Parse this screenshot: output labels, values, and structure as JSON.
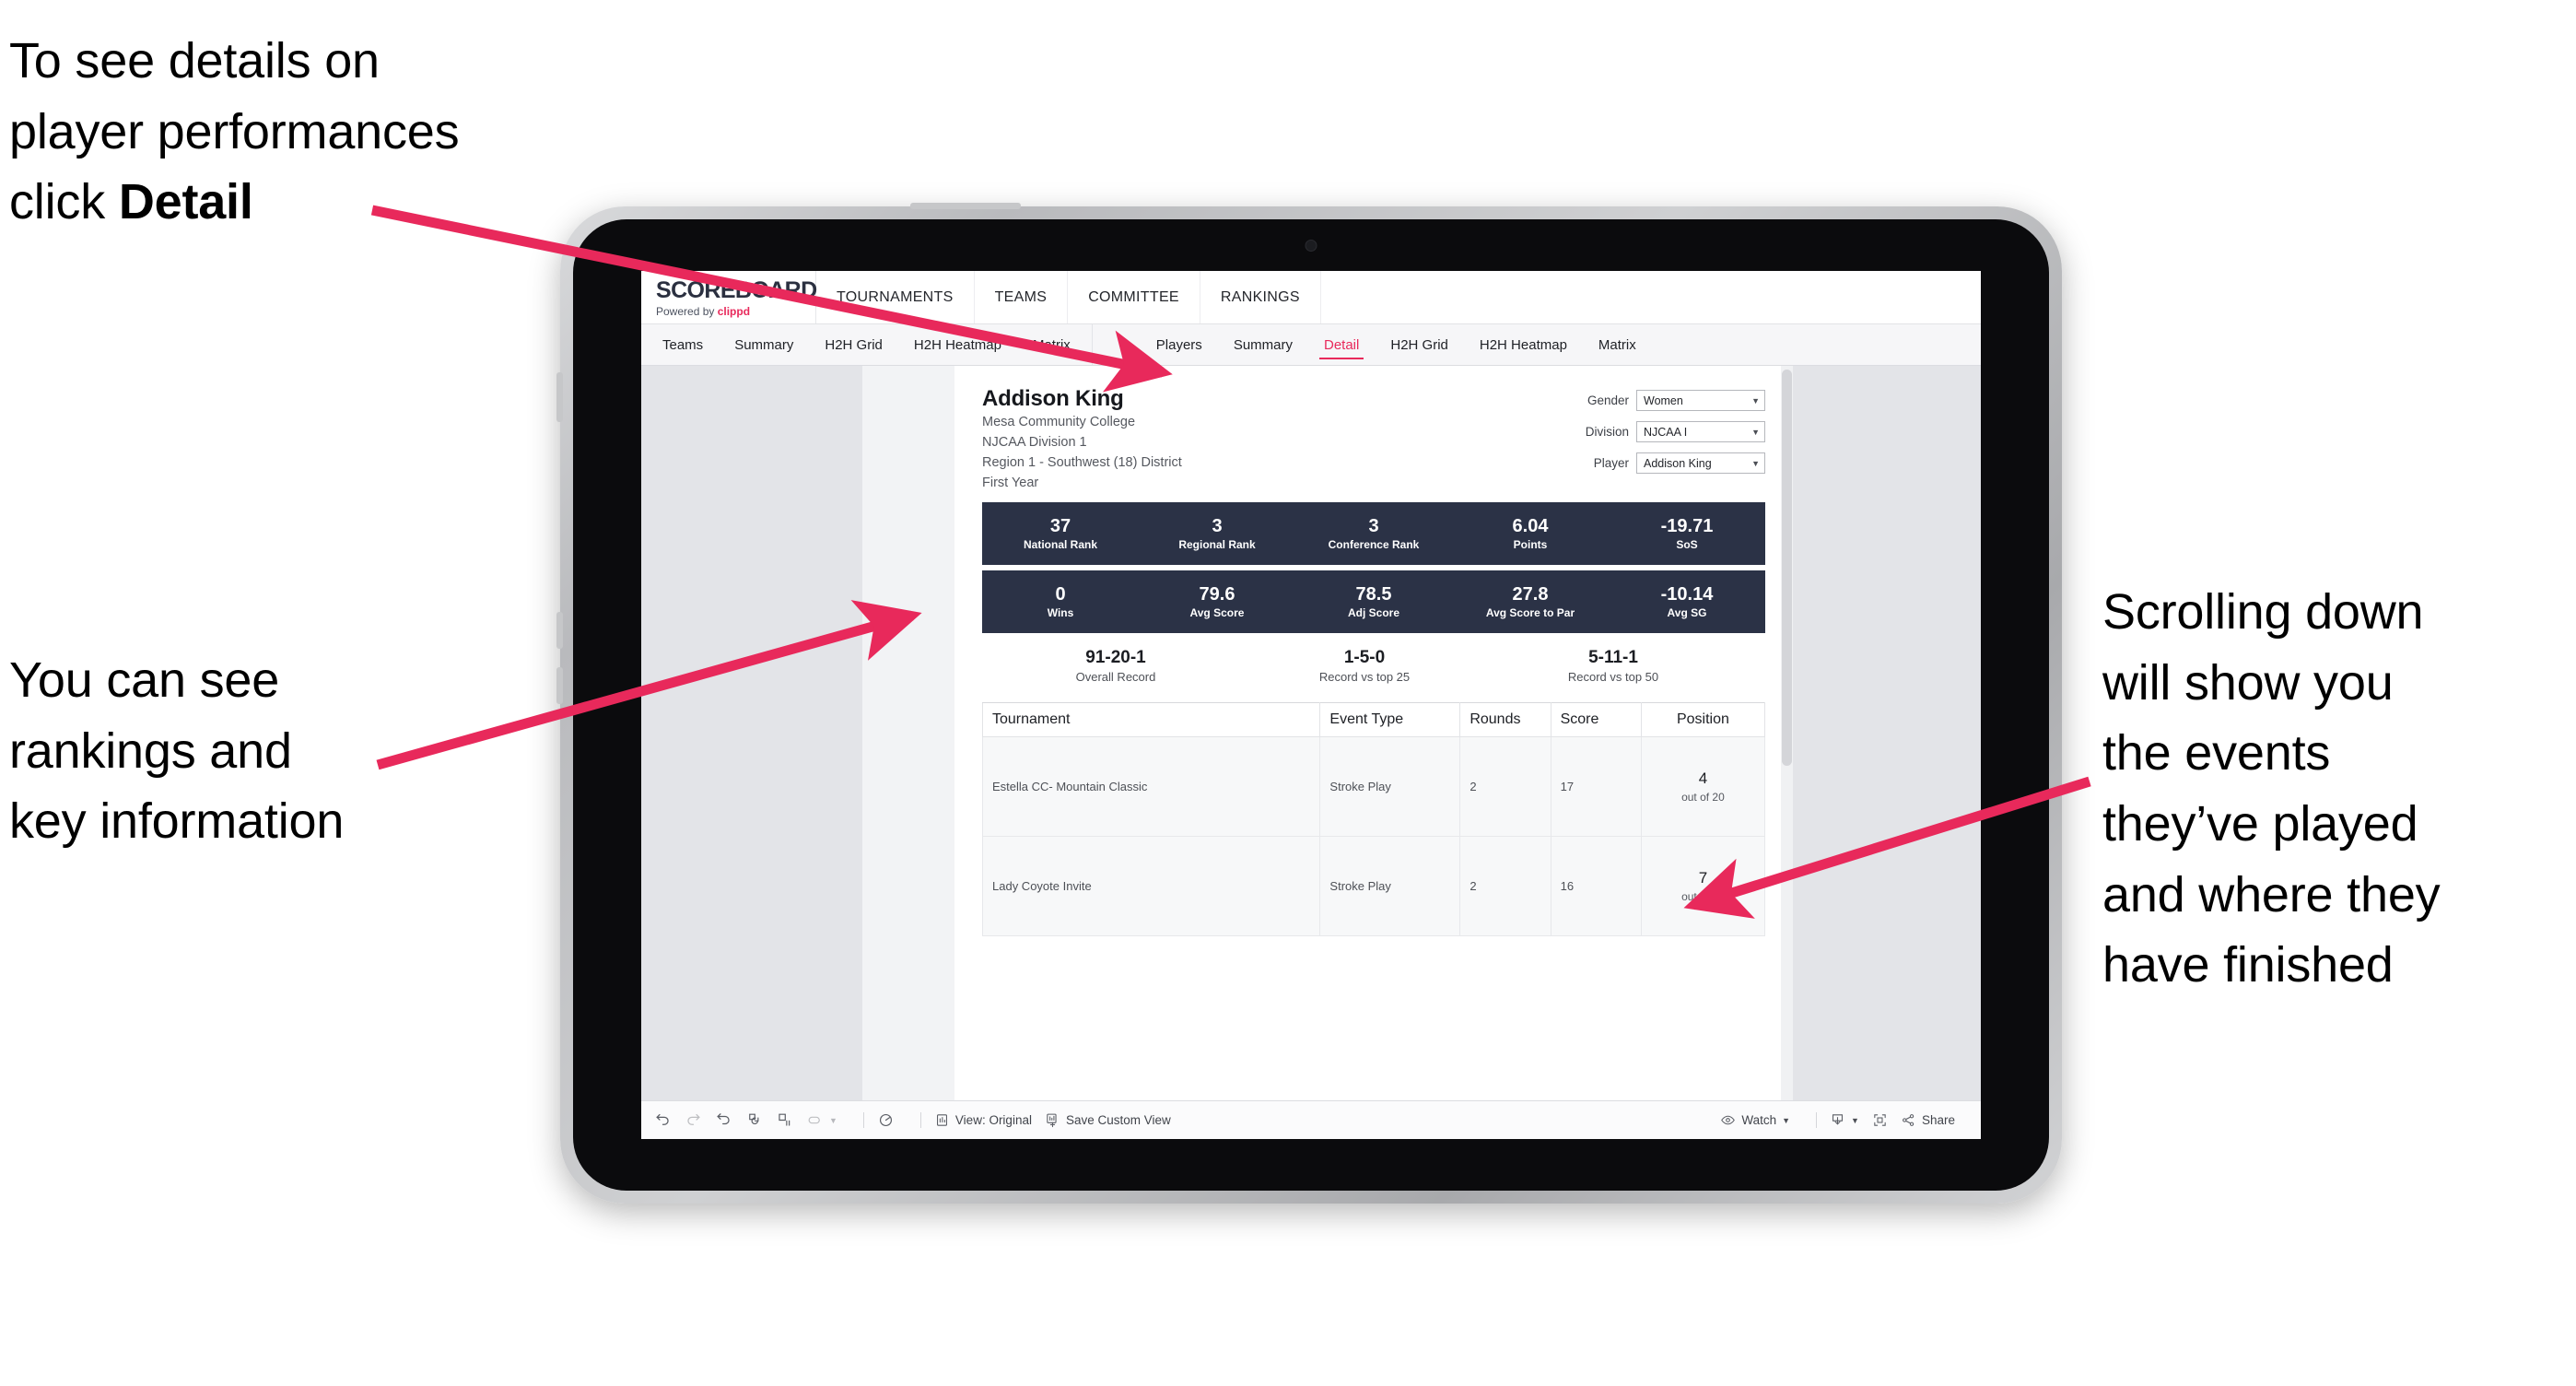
{
  "annotations": {
    "top_left": {
      "line1": "To see details on",
      "line2": "player performances",
      "line3_prefix": "click ",
      "line3_bold": "Detail"
    },
    "mid_left": {
      "line1": "You can see",
      "line2": "rankings and",
      "line3": "key information"
    },
    "right": {
      "line1": "Scrolling down",
      "line2": "will show you",
      "line3": "the events",
      "line4": "they’ve played",
      "line5": "and where they",
      "line6": "have finished"
    },
    "arrow_color": "#e8295b"
  },
  "app": {
    "logo": {
      "word": "SCOREBOARD",
      "powered_prefix": "Powered by ",
      "brand": "clippd"
    },
    "main_nav": [
      "TOURNAMENTS",
      "TEAMS",
      "COMMITTEE",
      "RANKINGS"
    ],
    "tabs_teams": [
      "Teams",
      "Summary",
      "H2H Grid",
      "H2H Heatmap",
      "Matrix"
    ],
    "tabs_players": [
      "Players",
      "Summary",
      "Detail",
      "H2H Grid",
      "H2H Heatmap",
      "Matrix"
    ],
    "active_tab": "Detail",
    "accent": "#e8295b",
    "statbar_color": "#2b3246"
  },
  "player": {
    "name": "Addison King",
    "school": "Mesa Community College",
    "division": "NJCAA Division 1",
    "region": "Region 1 - Southwest (18) District",
    "year": "First Year"
  },
  "filters": [
    {
      "label": "Gender",
      "value": "Women"
    },
    {
      "label": "Division",
      "value": "NJCAA I"
    },
    {
      "label": "Player",
      "value": "Addison King"
    }
  ],
  "stats_row1": [
    {
      "value": "37",
      "label": "National Rank"
    },
    {
      "value": "3",
      "label": "Regional Rank"
    },
    {
      "value": "3",
      "label": "Conference Rank"
    },
    {
      "value": "6.04",
      "label": "Points"
    },
    {
      "value": "-19.71",
      "label": "SoS"
    }
  ],
  "stats_row2": [
    {
      "value": "0",
      "label": "Wins"
    },
    {
      "value": "79.6",
      "label": "Avg Score"
    },
    {
      "value": "78.5",
      "label": "Adj Score"
    },
    {
      "value": "27.8",
      "label": "Avg Score to Par"
    },
    {
      "value": "-10.14",
      "label": "Avg SG"
    }
  ],
  "records": [
    {
      "value": "91-20-1",
      "label": "Overall Record"
    },
    {
      "value": "1-5-0",
      "label": "Record vs top 25"
    },
    {
      "value": "5-11-1",
      "label": "Record vs top 50"
    }
  ],
  "table": {
    "headers": [
      "Tournament",
      "Event Type",
      "Rounds",
      "Score",
      "Position"
    ],
    "rows": [
      {
        "tournament": "Estella CC- Mountain Classic",
        "event_type": "Stroke Play",
        "rounds": "2",
        "score": "17",
        "position": "4",
        "position_out": "out of 20"
      },
      {
        "tournament": "Lady Coyote Invite",
        "event_type": "Stroke Play",
        "rounds": "2",
        "score": "16",
        "position": "7",
        "position_out": "out of 20"
      }
    ]
  },
  "toolbar": {
    "view_original": "View: Original",
    "save_custom_view": "Save Custom View",
    "watch": "Watch",
    "share": "Share"
  }
}
